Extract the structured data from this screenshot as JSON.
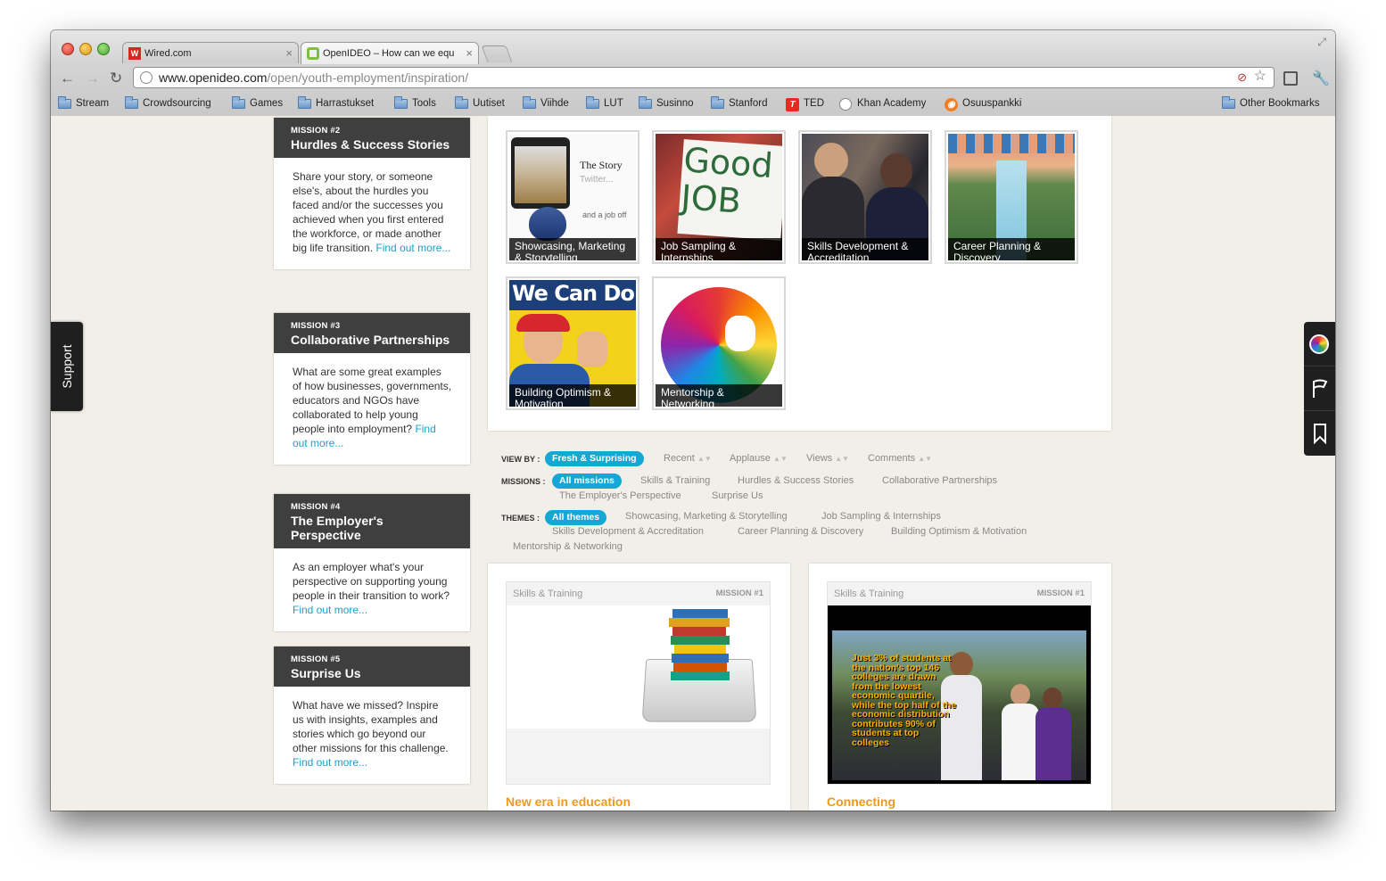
{
  "browser": {
    "tabs": [
      {
        "label": "Wired.com",
        "active": false
      },
      {
        "label": "OpenIDEO – How can we equ",
        "active": true
      }
    ],
    "url_host": "www.openideo.com",
    "url_path": "/open/youth-employment/inspiration/",
    "bookmarks": [
      "Stream",
      "Crowdsourcing",
      "Games",
      "Harrastukset",
      "Tools",
      "Uutiset",
      "Viihde",
      "LUT",
      "Susinno",
      "Stanford",
      "TED",
      "Khan Academy",
      "Osuuspankki",
      "Other Bookmarks"
    ]
  },
  "missions": [
    {
      "num": "MISSION #2",
      "title": "Hurdles & Success Stories",
      "text": "Share your story, or someone else's, about the hurdles you faced and/or the successes you achieved when you first entered the workforce, or made another big life transition.",
      "link": "Find out more..."
    },
    {
      "num": "MISSION #3",
      "title": "Collaborative Partnerships",
      "text": "What are some great examples of how businesses, governments, educators and NGOs have collaborated to help young people into employment?",
      "link": "Find out more..."
    },
    {
      "num": "MISSION #4",
      "title": "The Employer's Perspective",
      "text": "As an employer what's your perspective on supporting young people in their transition to work?",
      "link": "Find out more..."
    },
    {
      "num": "MISSION #5",
      "title": "Surprise Us",
      "text": "What have we missed? Inspire us with insights, examples and stories which go beyond our other missions for this challenge.",
      "link": "Find out more..."
    }
  ],
  "support_label": "Support",
  "themes_gallery": [
    {
      "caption": "Showcasing, Marketing & Storytelling",
      "inner_title": "The Story",
      "inner_sub": "Twitter...",
      "inner_foot": "and a job off"
    },
    {
      "caption": "Job Sampling & Internships",
      "inner_title": "Good JOB"
    },
    {
      "caption": "Skills Development & Accreditation"
    },
    {
      "caption": "Career Planning & Discovery"
    },
    {
      "caption": "Building Optimism & Motivation",
      "inner_title": "We Can Do It!"
    },
    {
      "caption": "Mentorship & Networking"
    }
  ],
  "filters": {
    "view_by_label": "VIEW BY :",
    "view_by_active": "Fresh & Surprising",
    "view_by": [
      "Recent",
      "Applause",
      "Views",
      "Comments"
    ],
    "missions_label": "MISSIONS :",
    "missions_active": "All missions",
    "missions": [
      "Skills & Training",
      "Hurdles & Success Stories",
      "Collaborative Partnerships",
      "The Employer's Perspective",
      "Surprise Us"
    ],
    "themes_label": "THEMES :",
    "themes_active": "All themes",
    "themes": [
      "Showcasing, Marketing & Storytelling",
      "Job Sampling & Internships",
      "Skills Development & Accreditation",
      "Career Planning & Discovery",
      "Building Optimism & Motivation",
      "Mentorship & Networking"
    ]
  },
  "ideas": [
    {
      "tag": "Skills & Training",
      "mission": "MISSION #1",
      "title": "New era in education"
    },
    {
      "tag": "Skills & Training",
      "mission": "MISSION #1",
      "title": "Connecting",
      "overlay": "Just 3% of students at the nation's top 146 colleges are drawn from the lowest economic quartile, while the top half of the economic distribution contributes 90% of students at top colleges"
    }
  ],
  "colors": {
    "accent": "#15a7d6",
    "idea_title": "#ef9a1a",
    "mission_head": "#3f3f3f",
    "page_bg": "#f2efe8"
  }
}
